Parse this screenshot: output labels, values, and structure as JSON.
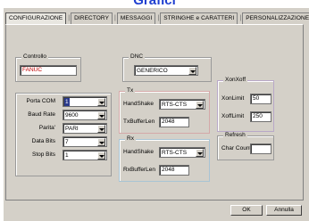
{
  "header": {
    "title": "Grafici"
  },
  "tabs": [
    {
      "label": "CONFIGURAZIONE"
    },
    {
      "label": "DIRECTORY"
    },
    {
      "label": "MESSAGGI"
    },
    {
      "label": "STRINGHE e CARATTERI"
    },
    {
      "label": "PERSONALIZZAZIONE"
    }
  ],
  "controllo": {
    "title": "Controllo",
    "value": "FANUC"
  },
  "dnc": {
    "title": "DNC",
    "value": "GENERICO"
  },
  "serial": {
    "porta_com": {
      "label": "Porta COM",
      "value": "1"
    },
    "baud_rate": {
      "label": "Baud Rate",
      "value": "9600"
    },
    "parita": {
      "label": "Parita'",
      "value": "PARI"
    },
    "data_bits": {
      "label": "Data Bits",
      "value": "7"
    },
    "stop_bits": {
      "label": "Stop Bits",
      "value": "1"
    }
  },
  "tx": {
    "title": "Tx",
    "handshake_label": "HandShake",
    "handshake_value": "RTS-CTS",
    "buffer_label": "TxBufferLen",
    "buffer_value": "2048"
  },
  "rx": {
    "title": "Rx",
    "handshake_label": "HandShake",
    "handshake_value": "RTS-CTS",
    "buffer_label": "RxBufferLen",
    "buffer_value": "2048"
  },
  "xonxoff": {
    "title": "XonXoff",
    "xon_label": "XonLimit",
    "xon_value": "50",
    "xoff_label": "XoffLimit",
    "xoff_value": "250"
  },
  "refresh": {
    "title": "Refresh",
    "char_count_label": "Char Count",
    "char_count_value": ""
  },
  "buttons": {
    "ok": "OK",
    "annulla": "Annulla"
  },
  "colors": {
    "title": "#1f3fd0",
    "tx_border": "#d4a8a8",
    "rx_border": "#a8c4d4",
    "xon_border": "#b8a8c8"
  }
}
